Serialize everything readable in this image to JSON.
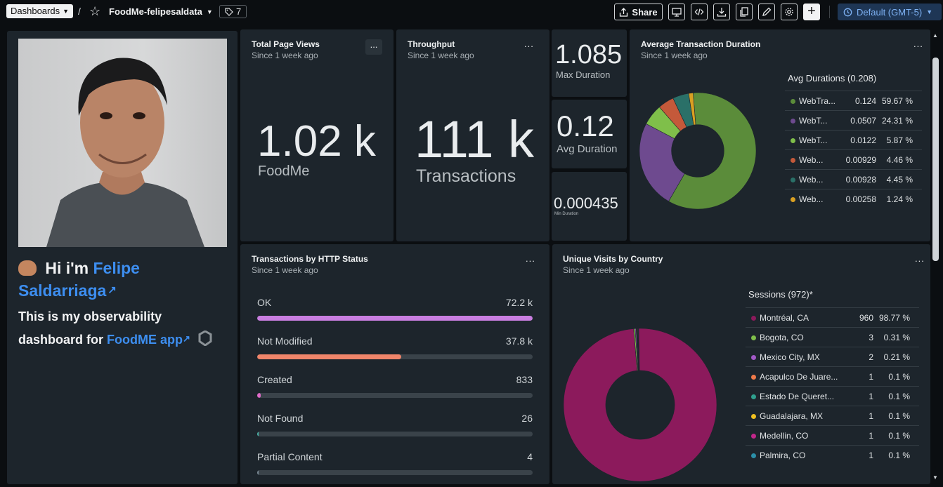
{
  "topbar": {
    "dashboards_label": "Dashboards",
    "separator": "/",
    "dashboard_name": "FoodMe-felipesaldata",
    "tag_count": "7",
    "share_label": "Share",
    "timezone_label": "Default (GMT-5)"
  },
  "intro": {
    "greeting_prefix": "Hi i'm",
    "name_line1": "Felipe",
    "name_line2": "Saldarriaga",
    "desc_line1": "This is my observability",
    "desc_prefix": "dashboard for",
    "app_link": "FoodME app"
  },
  "total_page_views": {
    "title": "Total Page Views",
    "subtitle": "Since 1 week ago",
    "value": "1.02 k",
    "label": "FoodMe"
  },
  "throughput": {
    "title": "Throughput",
    "subtitle": "Since 1 week ago",
    "value": "111 k",
    "label": "Transactions"
  },
  "max_duration": {
    "value": "1.085",
    "label": "Max Duration"
  },
  "avg_duration": {
    "value": "0.12",
    "label": "Avg Duration"
  },
  "min_duration": {
    "value": "0.000435",
    "label": "Min Duration"
  },
  "avg_tx": {
    "title": "Average Transaction Duration",
    "subtitle": "Since 1 week ago",
    "legend_title": "Avg Durations (0.208)"
  },
  "http_status": {
    "title": "Transactions by HTTP Status",
    "subtitle": "Since 1 week ago",
    "rows": [
      {
        "name": "OK",
        "value": "72.2 k",
        "fraction": 1.0,
        "color": "#c97ee0"
      },
      {
        "name": "Not Modified",
        "value": "37.8 k",
        "fraction": 0.524,
        "color": "#f0856a"
      },
      {
        "name": "Created",
        "value": "833",
        "fraction": 0.0115,
        "color": "#e06bc9"
      },
      {
        "name": "Not Found",
        "value": "26",
        "fraction": 0.0004,
        "color": "#49b3a8"
      },
      {
        "name": "Partial Content",
        "value": "4",
        "fraction": 0.0001,
        "color": "#7a8a96"
      }
    ]
  },
  "visits": {
    "title": "Unique Visits by Country",
    "subtitle": "Since 1 week ago",
    "legend_title": "Sessions (972)*"
  },
  "chart_data": [
    {
      "type": "pie",
      "categories": [
        "WebTra...",
        "WebT...",
        "WebT...",
        "Web...",
        "Web...",
        "Web..."
      ],
      "values": [
        0.124,
        0.0507,
        0.0122,
        0.00929,
        0.00928,
        0.00258
      ],
      "percents": [
        "59.67 %",
        "24.31 %",
        "5.87 %",
        "4.46 %",
        "4.45 %",
        "1.24 %"
      ],
      "value_labels": [
        "0.124",
        "0.0507",
        "0.0122",
        "0.00929",
        "0.00928",
        "0.00258"
      ],
      "colors": [
        "#5b8c3a",
        "#6e4a8f",
        "#7fbf4a",
        "#c4593a",
        "#2a7068",
        "#d9a022"
      ],
      "title": "Avg Durations (0.208)"
    },
    {
      "type": "pie",
      "categories": [
        "Montréal, CA",
        "Bogota, CO",
        "Mexico City, MX",
        "Acapulco De Juare...",
        "Estado De Queret...",
        "Guadalajara, MX",
        "Medellin, CO",
        "Palmira, CO"
      ],
      "values": [
        960,
        3,
        2,
        1,
        1,
        1,
        1,
        1
      ],
      "percents": [
        "98.77 %",
        "0.31 %",
        "0.21 %",
        "0.1 %",
        "0.1 %",
        "0.1 %",
        "0.1 %",
        "0.1 %"
      ],
      "value_labels": [
        "960",
        "3",
        "2",
        "1",
        "1",
        "1",
        "1",
        "1"
      ],
      "colors": [
        "#8c1a5c",
        "#7fbf4a",
        "#a259c7",
        "#ef7a4a",
        "#2fa08e",
        "#f0c020",
        "#c2278a",
        "#2b8fa8"
      ],
      "title": "Sessions (972)*"
    }
  ]
}
